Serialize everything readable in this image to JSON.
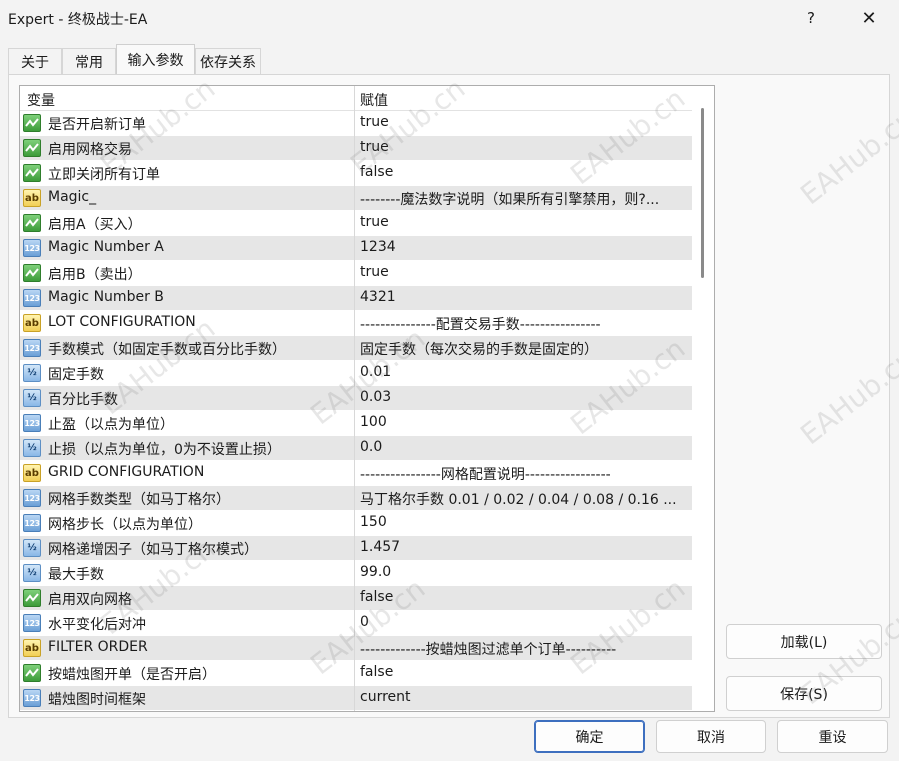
{
  "window": {
    "title": "Expert - 终极战士-EA",
    "help_glyph": "?",
    "close_glyph": "✕"
  },
  "tabs": [
    {
      "label": "关于"
    },
    {
      "label": "常用"
    },
    {
      "label": "输入参数"
    },
    {
      "label": "依存关系"
    }
  ],
  "grid": {
    "col_variable": "变量",
    "col_value": "赋值",
    "rows": [
      {
        "type": "bool",
        "name": "是否开启新订单",
        "value": "true"
      },
      {
        "type": "bool",
        "name": "启用网格交易",
        "value": "true"
      },
      {
        "type": "bool",
        "name": "立即关闭所有订单",
        "value": "false"
      },
      {
        "type": "string",
        "name": "Magic_",
        "value": "--------魔法数字说明（如果所有引擎禁用，则?..."
      },
      {
        "type": "bool",
        "name": "启用A（买入）",
        "value": "true"
      },
      {
        "type": "int",
        "name": "Magic Number  A",
        "value": "1234"
      },
      {
        "type": "bool",
        "name": "启用B（卖出）",
        "value": "true"
      },
      {
        "type": "int",
        "name": "Magic Number  B",
        "value": "4321"
      },
      {
        "type": "string",
        "name": "LOT CONFIGURATION",
        "value": "---------------配置交易手数----------------"
      },
      {
        "type": "int",
        "name": "手数模式（如固定手数或百分比手数）",
        "value": "固定手数（每次交易的手数是固定的）"
      },
      {
        "type": "double",
        "name": "固定手数",
        "value": "0.01"
      },
      {
        "type": "double",
        "name": "百分比手数",
        "value": "0.03"
      },
      {
        "type": "int",
        "name": "止盈（以点为单位）",
        "value": "100"
      },
      {
        "type": "double",
        "name": "止损（以点为单位，0为不设置止损）",
        "value": "0.0"
      },
      {
        "type": "string",
        "name": "GRID CONFIGURATION",
        "value": "----------------网格配置说明-----------------"
      },
      {
        "type": "int",
        "name": "网格手数类型（如马丁格尔）",
        "value": "马丁格尔手数  0.01 / 0.02 / 0.04 / 0.08 / 0.16 ..."
      },
      {
        "type": "int",
        "name": "网格步长（以点为单位）",
        "value": "150"
      },
      {
        "type": "double",
        "name": "网格递增因子（如马丁格尔模式）",
        "value": "1.457"
      },
      {
        "type": "double",
        "name": "最大手数",
        "value": "99.0"
      },
      {
        "type": "bool",
        "name": "启用双向网格",
        "value": "false"
      },
      {
        "type": "int",
        "name": "水平变化后对冲",
        "value": "0"
      },
      {
        "type": "string",
        "name": "FILTER ORDER",
        "value": "-------------按蜡烛图过滤单个订单----------"
      },
      {
        "type": "bool",
        "name": "按蜡烛图开单（是否开启）",
        "value": "false"
      },
      {
        "type": "int",
        "name": "蜡烛图时间框架",
        "value": "current"
      }
    ]
  },
  "icons": {
    "string_glyph": "ab",
    "int_glyph": "123",
    "double_glyph": "½"
  },
  "buttons": {
    "load": "加载(L)",
    "save": "保存(S)",
    "ok": "确定",
    "cancel": "取消",
    "reset": "重设"
  },
  "watermark": "EAHub.cn"
}
